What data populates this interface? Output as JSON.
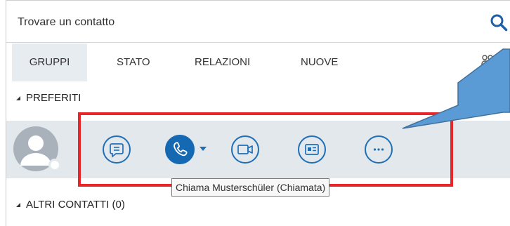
{
  "search": {
    "placeholder": "Trovare un contatto"
  },
  "tabs": [
    {
      "label": "GRUPPI",
      "active": true
    },
    {
      "label": "STATO",
      "active": false
    },
    {
      "label": "RELAZIONI",
      "active": false
    },
    {
      "label": "NUOVE",
      "active": false
    }
  ],
  "sections": {
    "favorites": "PREFERITI",
    "other_contacts": "ALTRI CONTATTI (0)"
  },
  "tooltip": {
    "text": "Chiama Musterschüler (Chiamata)"
  },
  "icons": {
    "search": "search-icon",
    "groups": "add-group-icon",
    "message": "chat-icon",
    "call": "phone-icon",
    "video": "video-camera-icon",
    "card": "contact-card-icon",
    "more": "more-options-icon"
  },
  "colors": {
    "accent": "#1568b2",
    "highlight_border": "#e8262a",
    "callout_fill": "#5b9bd5",
    "selected_row": "#e3e8ec"
  }
}
